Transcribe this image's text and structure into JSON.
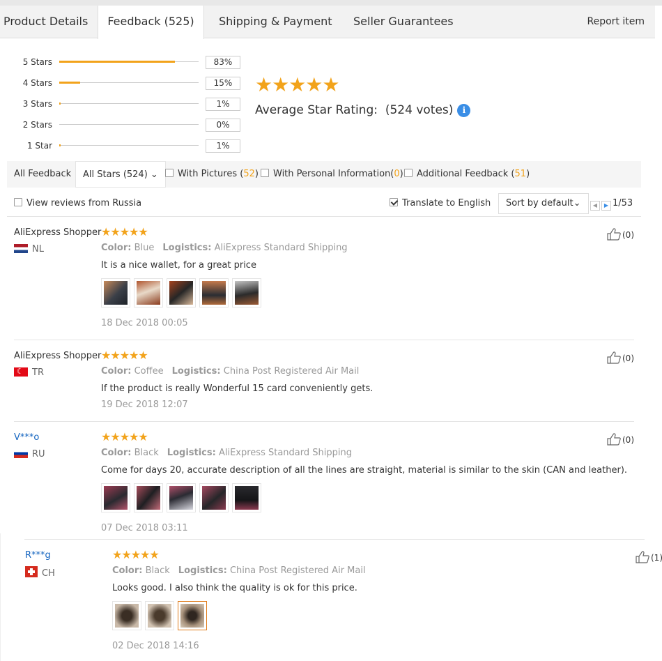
{
  "tabs": {
    "product_details": "Product Details",
    "feedback": "Feedback (525)",
    "shipping": "Shipping & Payment",
    "guarantees": "Seller Guarantees",
    "report": "Report item"
  },
  "histogram": [
    {
      "label": "5 Stars",
      "pct": "83%",
      "fill": 0.83
    },
    {
      "label": "4 Stars",
      "pct": "15%",
      "fill": 0.15
    },
    {
      "label": "3 Stars",
      "pct": "1%",
      "fill": 0.01
    },
    {
      "label": "2 Stars",
      "pct": "0%",
      "fill": 0.0
    },
    {
      "label": "1 Star",
      "pct": "1%",
      "fill": 0.01
    }
  ],
  "average": {
    "stars": "★★★★★",
    "label": "Average Star Rating:",
    "votes": "(524 votes)",
    "info_glyph": "i"
  },
  "filters": {
    "all_feedback": "All Feedback",
    "all_stars": "All Stars (524)",
    "all_stars_caret": "⌄",
    "with_pictures": "With Pictures (",
    "with_pictures_count": "52",
    "with_personal": "With Personal Information(",
    "with_personal_count": "0",
    "additional": "Additional Feedback (",
    "additional_count": "51",
    "close_paren": ")"
  },
  "options": {
    "view_russia": "View reviews from Russia",
    "translate": "Translate to English",
    "sort": "Sort by default",
    "sort_caret": "⌄",
    "page": "1/53"
  },
  "reviews": [
    {
      "user": "AliExpress Shopper",
      "country": "NL",
      "stars": "★★★★★",
      "color_label": "Color:",
      "color": "Blue",
      "logistics_label": "Logistics:",
      "logistics": "AliExpress Standard Shipping",
      "text": "It is a nice wallet, for a great price",
      "date": "18 Dec 2018 00:05",
      "helpful": "(0)"
    },
    {
      "user": "AliExpress Shopper",
      "country": "TR",
      "stars": "★★★★★",
      "color_label": "Color:",
      "color": "Coffee",
      "logistics_label": "Logistics:",
      "logistics": "China Post Registered Air Mail",
      "text": "If the product is really Wonderful 15 card conveniently gets.",
      "date": "19 Dec 2018 12:07",
      "helpful": "(0)"
    },
    {
      "user": "V***o",
      "country": "RU",
      "stars": "★★★★★",
      "color_label": "Color:",
      "color": "Black",
      "logistics_label": "Logistics:",
      "logistics": "AliExpress Standard Shipping",
      "text": "Come for days 20, accurate description of all the lines are straight, material is similar to the skin (CAN and leather).",
      "date": "07 Dec 2018 03:11",
      "helpful": "(0)"
    },
    {
      "user": "R***g",
      "country": "CH",
      "stars": "★★★★★",
      "color_label": "Color:",
      "color": "Black",
      "logistics_label": "Logistics:",
      "logistics": "China Post Registered Air Mail",
      "text": "Looks good. I also think the quality is ok for this price.",
      "date": "02 Dec 2018 14:16",
      "helpful": "(1)"
    }
  ],
  "colors": {
    "accent": "#f2a31b",
    "link": "#1565c0",
    "info": "#3a8ee6"
  }
}
